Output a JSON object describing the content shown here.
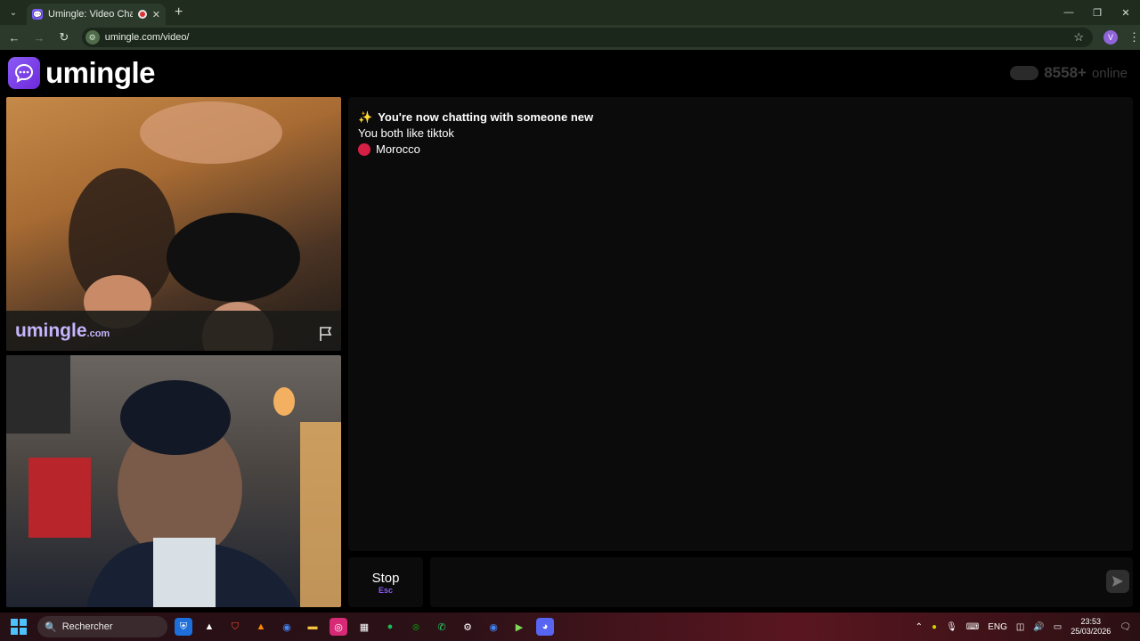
{
  "browser": {
    "tab_title": "Umingle: Video Chat with S",
    "url": "umingle.com/video/",
    "profile_initial": "V"
  },
  "header": {
    "logo_text": "umingle",
    "online_count": "8558+",
    "online_label": "online"
  },
  "remote_video": {
    "watermark": "umingle",
    "watermark_suffix": ".com"
  },
  "chat": {
    "messages": [
      {
        "icon": "✨",
        "text": "You're now chatting with someone new"
      },
      {
        "text": "You both like tiktok"
      },
      {
        "text": "Morocco"
      }
    ]
  },
  "controls": {
    "stop_label": "Stop",
    "stop_hint": "Esc"
  },
  "taskbar": {
    "search_label": "Rechercher",
    "language": "ENG",
    "time": "23:53",
    "date": "25/03/2026"
  },
  "colors": {
    "accent": "#8b5cf6",
    "country_flag": "#d61f45"
  }
}
